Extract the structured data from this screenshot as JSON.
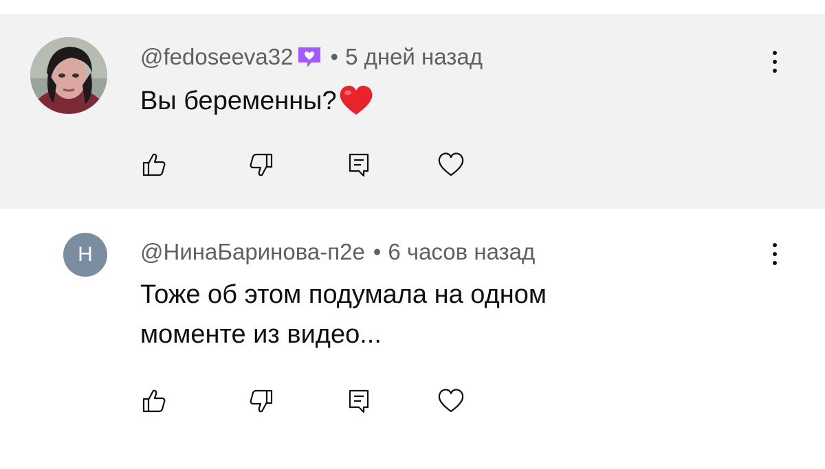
{
  "comments": [
    {
      "author": "@fedoseeva32",
      "has_member_badge": true,
      "badge_color": "#a259ff",
      "separator": "•",
      "time": "5 дней назад",
      "text": "Вы беременны?",
      "emoji": "heart-emoji",
      "highlighted": true,
      "avatar": "photo"
    },
    {
      "author": "@НинаБаринова-п2е",
      "has_member_badge": false,
      "separator": "•",
      "time": "6 часов назад",
      "text_lines": [
        "Тоже об этом подумала на одном",
        "моменте из видео..."
      ],
      "avatar_letter": "Н",
      "avatar_color": "#7b8da0",
      "highlighted": false
    }
  ],
  "colors": {
    "highlight_bg": "#f2f2f2",
    "meta_text": "#606060",
    "body_text": "#0f0f0f"
  },
  "icons": [
    "thumb-up-icon",
    "thumb-down-icon",
    "reply-icon",
    "heart-icon",
    "more-vert-icon"
  ]
}
